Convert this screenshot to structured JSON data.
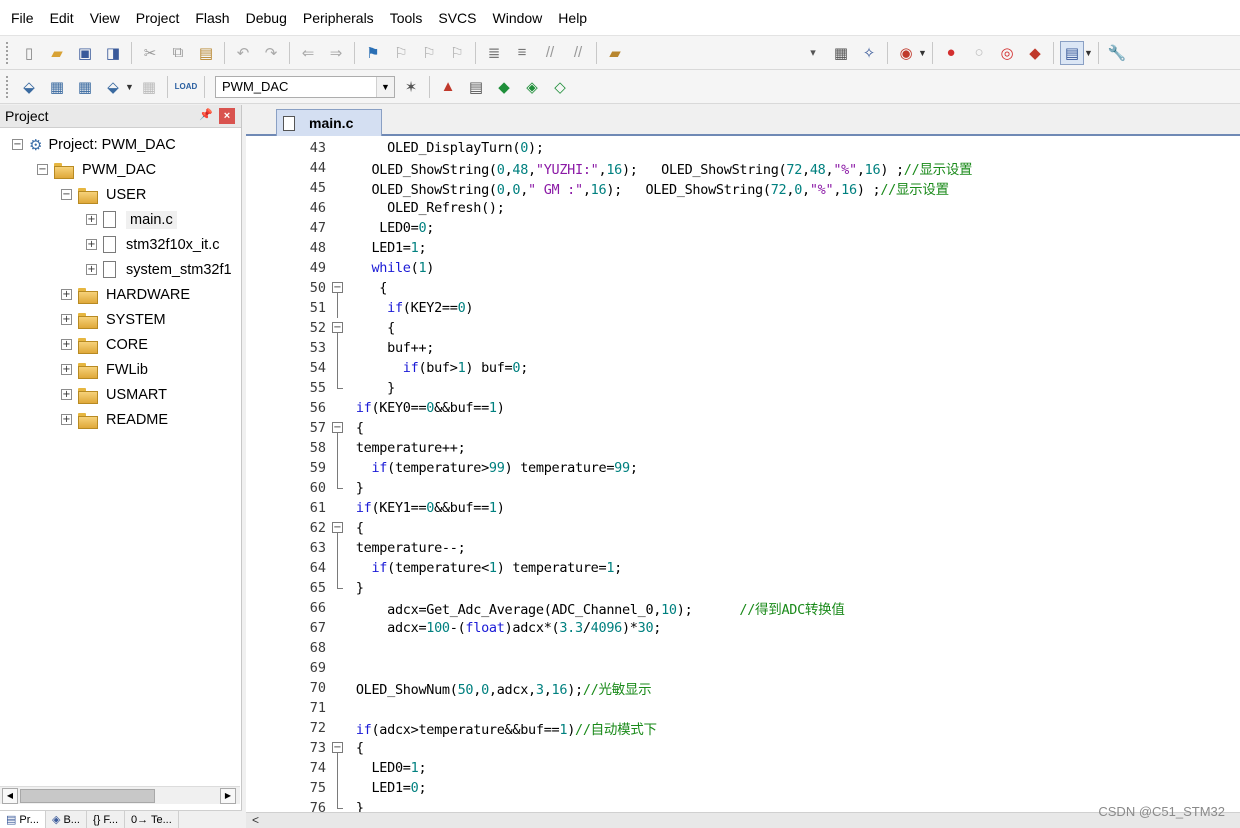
{
  "menu": [
    "File",
    "Edit",
    "View",
    "Project",
    "Flash",
    "Debug",
    "Peripherals",
    "Tools",
    "SVCS",
    "Window",
    "Help"
  ],
  "toolbar": {
    "target_select": "PWM_DAC",
    "load_label": "LOAD"
  },
  "project_panel": {
    "title": "Project",
    "root": "Project: PWM_DAC",
    "target": "PWM_DAC",
    "groups": {
      "user": "USER",
      "user_files": [
        "main.c",
        "stm32f10x_it.c",
        "system_stm32f1"
      ],
      "others": [
        "HARDWARE",
        "SYSTEM",
        "CORE",
        "FWLib",
        "USMART",
        "README"
      ]
    },
    "tabs": [
      "Pr...",
      "B...",
      "{} F...",
      "0→ Te..."
    ]
  },
  "editor": {
    "tab": "main.c",
    "lines": [
      {
        "n": "43",
        "text": "     OLED_DisplayTurn(0);"
      },
      {
        "n": "44",
        "text": "   OLED_ShowString(0,48,\"YUZHI:\",16);   OLED_ShowString(72,48,\"%\",16) ;//显示设置"
      },
      {
        "n": "45",
        "text": "   OLED_ShowString(0,0,\" GM :\",16);   OLED_ShowString(72,0,\"%\",16) ;//显示设置"
      },
      {
        "n": "46",
        "text": "     OLED_Refresh();"
      },
      {
        "n": "47",
        "text": "    LED0=0;"
      },
      {
        "n": "48",
        "text": "   LED1=1;"
      },
      {
        "n": "49",
        "text": "   while(1)"
      },
      {
        "n": "50",
        "text": "    {"
      },
      {
        "n": "51",
        "text": "     if(KEY2==0)"
      },
      {
        "n": "52",
        "text": "     {"
      },
      {
        "n": "53",
        "text": "     buf++;"
      },
      {
        "n": "54",
        "text": "       if(buf>1) buf=0;"
      },
      {
        "n": "55",
        "text": "     }"
      },
      {
        "n": "56",
        "text": " if(KEY0==0&&buf==1)"
      },
      {
        "n": "57",
        "text": " {"
      },
      {
        "n": "58",
        "text": " temperature++;"
      },
      {
        "n": "59",
        "text": "   if(temperature>99) temperature=99;"
      },
      {
        "n": "60",
        "text": " }"
      },
      {
        "n": "61",
        "text": " if(KEY1==0&&buf==1)"
      },
      {
        "n": "62",
        "text": " {"
      },
      {
        "n": "63",
        "text": " temperature--;"
      },
      {
        "n": "64",
        "text": "   if(temperature<1) temperature=1;"
      },
      {
        "n": "65",
        "text": " }"
      },
      {
        "n": "66",
        "text": "     adcx=Get_Adc_Average(ADC_Channel_0,10);      //得到ADC转换值"
      },
      {
        "n": "67",
        "text": "     adcx=100-(float)adcx*(3.3/4096)*30;"
      },
      {
        "n": "68",
        "text": ""
      },
      {
        "n": "69",
        "text": ""
      },
      {
        "n": "70",
        "text": " OLED_ShowNum(50,0,adcx,3,16);//光敏显示"
      },
      {
        "n": "71",
        "text": ""
      },
      {
        "n": "72",
        "text": " if(adcx>temperature&&buf==1)//自动模式下"
      },
      {
        "n": "73",
        "text": " {"
      },
      {
        "n": "74",
        "text": "   LED0=1;"
      },
      {
        "n": "75",
        "text": "   LED1=0;"
      },
      {
        "n": "76",
        "text": " }"
      }
    ]
  },
  "watermark": "CSDN @C51_STM32"
}
